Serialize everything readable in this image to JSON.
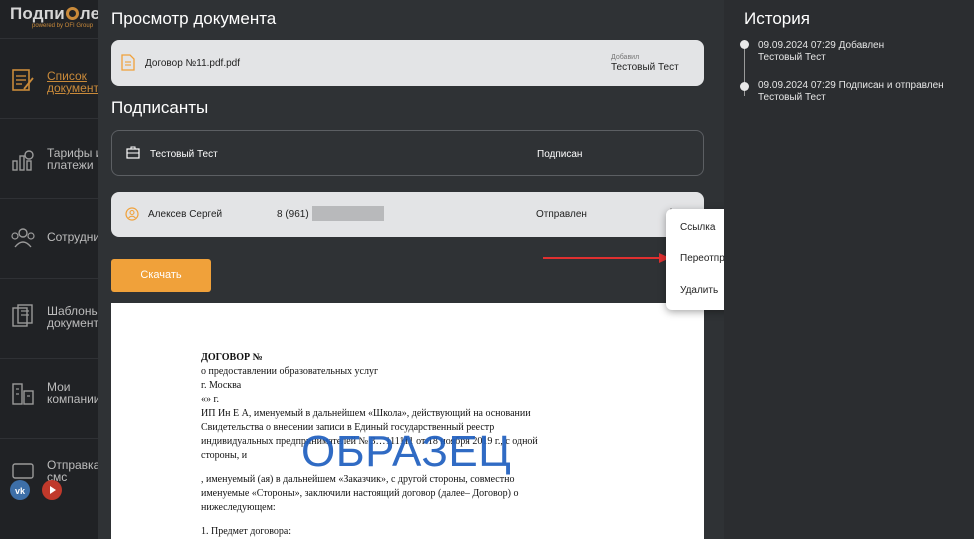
{
  "sidebar": {
    "logo": {
      "left": "Подпи",
      "right": "ле",
      "sub": "powered by OFI Group"
    },
    "items": [
      {
        "label": "Список\nдокументов",
        "icon": "document-list-icon",
        "active": true
      },
      {
        "label": "Тарифы и\nплатежи",
        "icon": "tariffs-icon",
        "active": false
      },
      {
        "label": "Сотрудники",
        "icon": "employees-icon",
        "active": false
      },
      {
        "label": "Шаблоны\nдокументов",
        "icon": "templates-icon",
        "active": false
      },
      {
        "label": "Мои\nкомпании",
        "icon": "companies-icon",
        "active": false
      },
      {
        "label": "Отправка\nсмс",
        "icon": "sms-icon",
        "active": false
      }
    ],
    "social": [
      "vk-icon",
      "youtube-icon"
    ]
  },
  "document": {
    "title": "Просмотр документа",
    "file_name": "Договор №11.pdf.pdf",
    "added_label": "Добавил",
    "added_by": "Тестовый Тест"
  },
  "signers": {
    "title": "Подписанты",
    "items": [
      {
        "name": "Тестовый Тест",
        "phone": "",
        "status": "Подписан"
      },
      {
        "name": "Алексев Сергей",
        "phone": "8 (961)",
        "status": "Отправлен"
      }
    ]
  },
  "download_label": "Скачать",
  "context_menu": {
    "items": [
      "Ссылка",
      "Переотправить",
      "Удалить"
    ]
  },
  "preview": {
    "lines": [
      "ДОГОВОР №",
      "о предоставлении образовательных услуг",
      "г. Москва",
      "«»    г.",
      "ИП Ин Е А, именуемый в дальнейшем «Школа», действующий на основании",
      "Свидетельства о внесении записи в Единый государственный реестр",
      "индивидуальных предпринимателей № 3…111111 от 18 ноября 2019 г., с одной",
      "стороны, и",
      "",
      ", именуемый (ая) в дальнейшем «Заказчик», с другой стороны, совместно",
      "именуемые «Стороны», заключили настоящий договор (далее– Договор) о",
      "нижеследующем:",
      "",
      "1. Предмет договора:"
    ],
    "watermark": "ОБРАЗЕЦ"
  },
  "history": {
    "title": "История",
    "events": [
      {
        "line1": "09.09.2024 07:29 Добавлен",
        "line2": "Тестовый Тест"
      },
      {
        "line1": "09.09.2024 07:29 Подписан и отправлен",
        "line2": "Тестовый Тест"
      }
    ]
  },
  "colors": {
    "accent": "#f0a13a",
    "watermark": "#1f5fbf",
    "arrow": "#e03030"
  }
}
